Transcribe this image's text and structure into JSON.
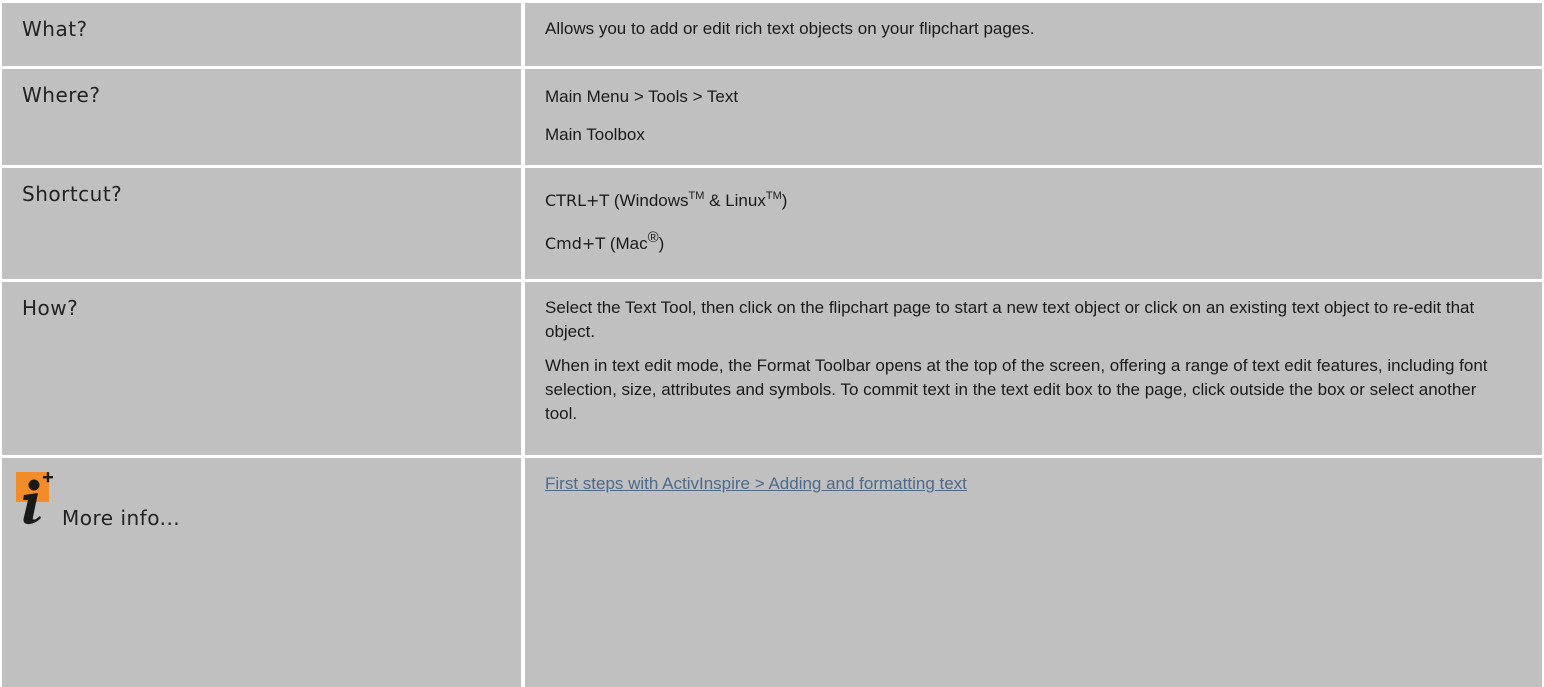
{
  "rows": {
    "what": {
      "label": "What?",
      "text": "Allows you to add or edit rich text objects on your flipchart pages."
    },
    "where": {
      "label": "Where?",
      "lines": [
        "Main Menu > Tools > Text",
        "Main Toolbox"
      ]
    },
    "shortcut": {
      "label": "Shortcut?",
      "windows": {
        "keys": "CTRL+T",
        "prefix": " (Windows",
        "tm1": "TM",
        "mid": " & Linux",
        "tm2": "TM",
        "suffix": ")"
      },
      "mac": {
        "keys": "Cmd+T",
        "prefix": " (Mac",
        "reg": "®",
        "suffix": ")"
      }
    },
    "how": {
      "label": "How?",
      "para1": "Select the Text Tool, then click on the flipchart page to start a new text object or click on an existing text object to re-edit that object.",
      "para2": "When in text edit mode, the Format Toolbar opens at the top of the screen, offering a range of text edit features, including font selection, size, attributes and symbols. To commit text in the text edit box to the page, click outside the box or select another tool."
    },
    "more_info": {
      "label": "More info...",
      "icon": "info-plus-icon",
      "link_text": "First steps with ActivInspire > Adding and formatting text"
    }
  },
  "colors": {
    "cell_background": "#c0c0c0",
    "grid_lines": "#ffffff",
    "link": "#4d6a88",
    "icon_orange": "#f28c28"
  }
}
